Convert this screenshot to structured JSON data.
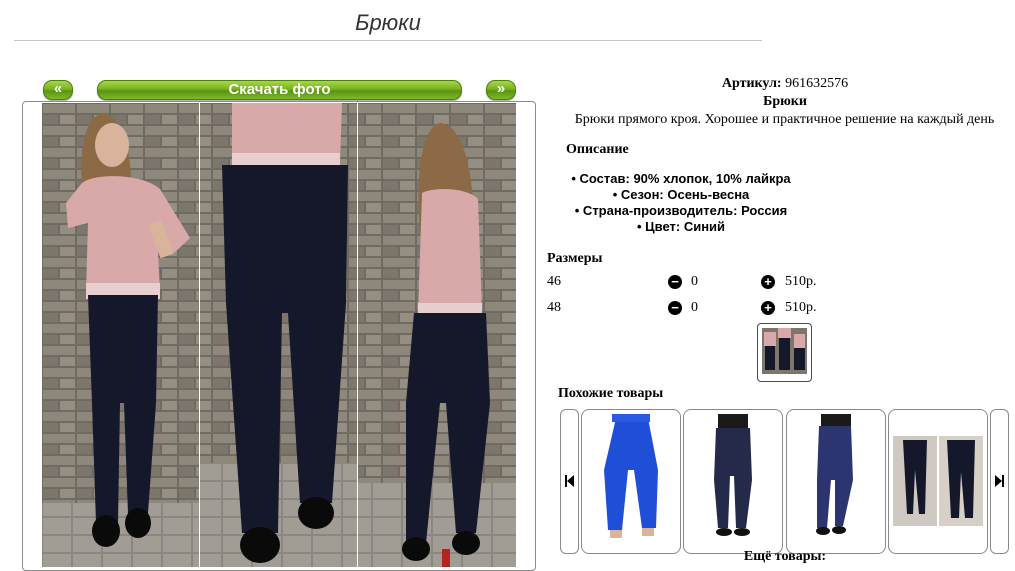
{
  "page": {
    "title": "Брюки"
  },
  "gallery": {
    "prev_label": "«",
    "next_label": "»",
    "download_label": "Скачать фото"
  },
  "product": {
    "article_label": "Артикул:",
    "article_value": "961632576",
    "name": "Брюки",
    "short_description": "Брюки прямого кроя. Хорошее и практичное решение на каждый день",
    "description_heading": "Описание",
    "specs": [
      "• Состав: 90% хлопок, 10% лайкра",
      "• Сезон: Осень-весна",
      "• Страна-производитель: Россия",
      "• Цвет: Синий"
    ]
  },
  "sizes": {
    "heading": "Размеры",
    "rows": [
      {
        "size": "46",
        "qty": "0",
        "price": "510р."
      },
      {
        "size": "48",
        "qty": "0",
        "price": "510р."
      }
    ],
    "minus_symbol": "−",
    "plus_symbol": "+"
  },
  "similar": {
    "heading": "Похожие товары",
    "prev_icon": "skip-back-icon",
    "next_icon": "skip-forward-icon",
    "more_label": "Ещё товары:"
  },
  "colors": {
    "button_green": "#79b21f",
    "pants_navy": "#14182a",
    "blouse_pink": "#d9a9aa",
    "similar_blue": "#1f4fd6",
    "similar_navy": "#242a4a"
  }
}
